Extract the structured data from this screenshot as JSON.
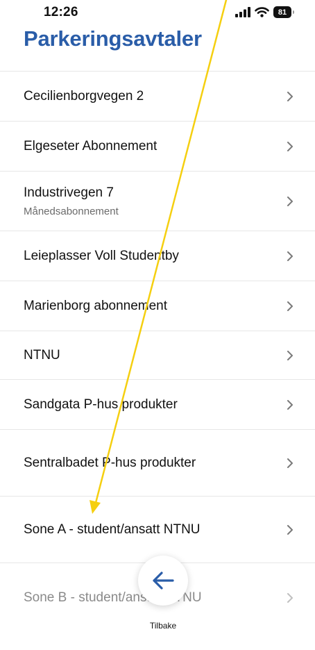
{
  "status_bar": {
    "time": "12:26",
    "battery": "81"
  },
  "title": "Parkeringsavtaler",
  "items": [
    {
      "label": "Cecilienborgvegen 2",
      "sub": ""
    },
    {
      "label": "Elgeseter Abonnement",
      "sub": ""
    },
    {
      "label": "Industrivegen 7",
      "sub": "Månedsabonnement"
    },
    {
      "label": "Leieplasser Voll Studentby",
      "sub": ""
    },
    {
      "label": "Marienborg abonnement",
      "sub": ""
    },
    {
      "label": "NTNU",
      "sub": ""
    },
    {
      "label": "Sandgata P-hus produkter",
      "sub": ""
    },
    {
      "label": "Sentralbadet P-hus produkter",
      "sub": ""
    },
    {
      "label": "Sone A - student/ansatt NTNU",
      "sub": ""
    },
    {
      "label": "Sone B - student/ansatt NTNU",
      "sub": ""
    }
  ],
  "back_button": {
    "label": "Tilbake"
  },
  "colors": {
    "title": "#2a5da8",
    "annotation_arrow": "#f5cf10"
  }
}
